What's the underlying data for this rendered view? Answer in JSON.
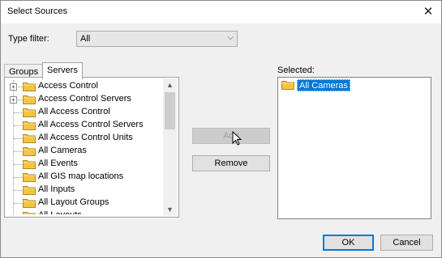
{
  "window": {
    "title": "Select Sources"
  },
  "type_filter": {
    "label": "Type filter:",
    "value": "All"
  },
  "tabs": [
    {
      "label": "Groups",
      "active": false
    },
    {
      "label": "Servers",
      "active": true
    }
  ],
  "tree_items": [
    {
      "label": "Access Control",
      "expandable": true
    },
    {
      "label": "Access Control Servers",
      "expandable": true
    },
    {
      "label": "All Access Control",
      "expandable": false
    },
    {
      "label": "All Access Control Servers",
      "expandable": false
    },
    {
      "label": "All Access Control Units",
      "expandable": false
    },
    {
      "label": "All Cameras",
      "expandable": false
    },
    {
      "label": "All Events",
      "expandable": false
    },
    {
      "label": "All GIS map locations",
      "expandable": false
    },
    {
      "label": "All Inputs",
      "expandable": false
    },
    {
      "label": "All Layout Groups",
      "expandable": false
    },
    {
      "label": "All Layouts",
      "expandable": false
    }
  ],
  "buttons": {
    "add": "Add",
    "remove": "Remove",
    "ok": "OK",
    "cancel": "Cancel"
  },
  "selected": {
    "label": "Selected:",
    "items": [
      "All Cameras"
    ]
  },
  "icons": {
    "close": "close-icon",
    "folder": "folder-icon",
    "dropdown": "chevron-down-icon"
  },
  "colors": {
    "selection": "#0078d7",
    "folder": "#f4c542",
    "dialog_bg": "#f0f0f0"
  }
}
